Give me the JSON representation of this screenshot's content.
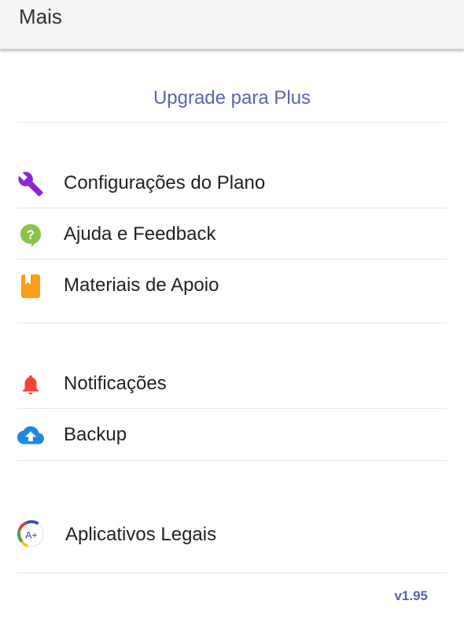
{
  "app_bar": {
    "title": "Mais"
  },
  "upgrade": {
    "label": "Upgrade para Plus"
  },
  "menu": {
    "plan_settings": {
      "label": "Configurações do Plano",
      "icon": "wrench-icon",
      "color": "#8e24d6"
    },
    "help_feedback": {
      "label": "Ajuda e Feedback",
      "icon": "help-chat-icon",
      "color": "#8bc34a"
    },
    "support_materials": {
      "label": "Materiais de Apoio",
      "icon": "book-icon",
      "color": "#fb9c1a"
    },
    "notifications": {
      "label": "Notificações",
      "icon": "bell-icon",
      "color": "#f44336"
    },
    "backup": {
      "label": "Backup",
      "icon": "cloud-upload-icon",
      "color": "#1e88e5"
    },
    "cool_apps": {
      "label": "Aplicativos Legais",
      "icon": "app-logo-icon",
      "icon_text": "A+"
    }
  },
  "footer": {
    "version": "v1.95"
  }
}
